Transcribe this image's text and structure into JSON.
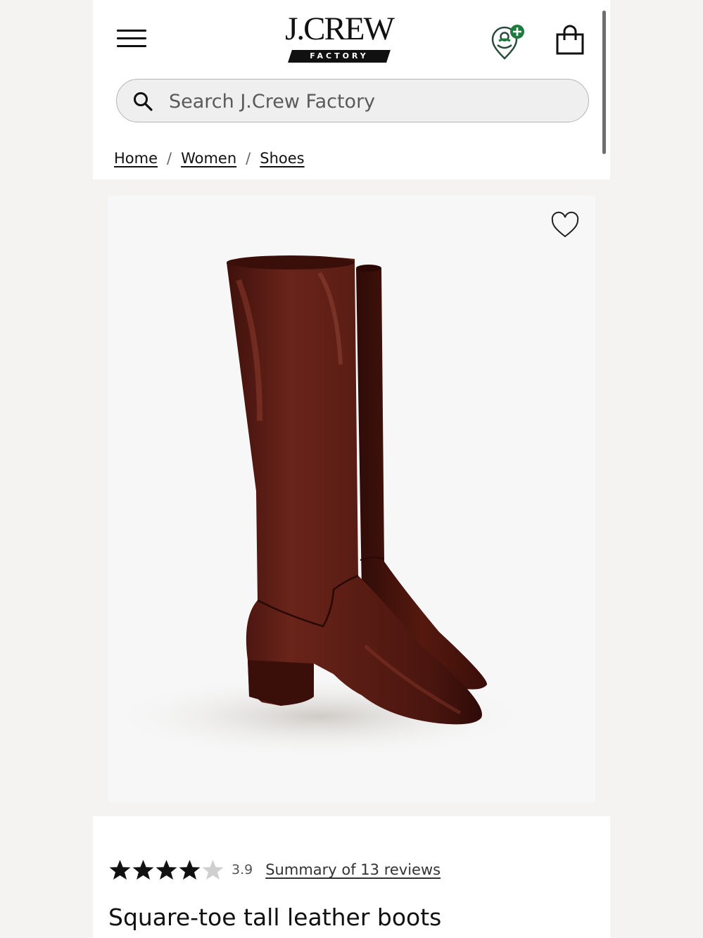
{
  "header": {
    "brand": "J.CREW",
    "brand_sub": "FACTORY",
    "menu_icon": "hamburger-menu-icon",
    "account_icon": "account-rewards-icon",
    "bag_icon": "shopping-bag-icon",
    "accent_color": "#1f7a3d"
  },
  "search": {
    "placeholder": "Search J.Crew Factory",
    "value": ""
  },
  "breadcrumb": {
    "items": [
      "Home",
      "Women",
      "Shoes"
    ],
    "separator": "/"
  },
  "product": {
    "wishlist_icon": "heart-icon",
    "rating": 3.9,
    "rating_text": "3.9",
    "stars_total": 5,
    "reviews_link": "Summary of 13 reviews",
    "title": "Square-toe tall leather boots",
    "boot_color": "#5a1d14"
  }
}
